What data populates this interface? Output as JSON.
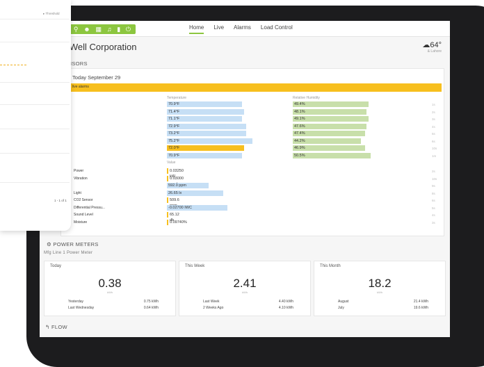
{
  "nav": {
    "icons": [
      "location-pin-icon",
      "person-icon",
      "building-icon",
      "bell-icon",
      "chart-icon",
      "power-icon"
    ],
    "tabs": [
      "Home",
      "Live",
      "Alarms",
      "Load Control"
    ]
  },
  "header": {
    "company": "lWell Corporation",
    "temperature": "64°",
    "temp_sub": "& Lahore"
  },
  "sensors": {
    "title": "SENSORS",
    "date": "Today September 29",
    "alarm_text": "live alarms",
    "temp_header": "Temperature",
    "humidity_header": "Relative Humidity",
    "value_header": "Value",
    "temp_rows": [
      {
        "temp": "70.9°F",
        "temp_pct": 0.36,
        "hum": "49.4%",
        "hum_pct": 0.39,
        "alert": false,
        "ts": "1s"
      },
      {
        "temp": "71.4°F",
        "temp_pct": 0.37,
        "hum": "48.1%",
        "hum_pct": 0.38,
        "alert": false,
        "ts": "2s"
      },
      {
        "temp": "71.1°F",
        "temp_pct": 0.36,
        "hum": "49.1%",
        "hum_pct": 0.39,
        "alert": false,
        "ts": "3s"
      },
      {
        "temp": "72.9°F",
        "temp_pct": 0.38,
        "hum": "47.6%",
        "hum_pct": 0.38,
        "alert": false,
        "ts": "4s"
      },
      {
        "temp": "73.2°F",
        "temp_pct": 0.38,
        "hum": "47.4%",
        "hum_pct": 0.37,
        "alert": false,
        "ts": "5s"
      },
      {
        "temp": "75.2°F",
        "temp_pct": 0.41,
        "hum": "44.2%",
        "hum_pct": 0.35,
        "alert": false,
        "ts": "6s"
      },
      {
        "temp": "72.0°F",
        "temp_pct": 0.37,
        "hum": "46.9%",
        "hum_pct": 0.37,
        "alert": true,
        "ts": "10s"
      },
      {
        "temp": "70.9°F",
        "temp_pct": 0.36,
        "hum": "50.5%",
        "hum_pct": 0.4,
        "alert": false,
        "ts": "1m"
      }
    ],
    "value_rows": [
      {
        "label": "Power",
        "value": "0.03250 kW",
        "pct": 0.01,
        "alert": true,
        "ts": "2s"
      },
      {
        "label": "Vibration",
        "value": "0.03000 mm/s",
        "pct": 0.01,
        "alert": false,
        "ts": "10s"
      },
      {
        "label": "",
        "value": "592.0 ppm",
        "pct": 0.2,
        "alert": false,
        "ts": "9s"
      },
      {
        "label": "Light",
        "value": "26.65 lx",
        "pct": 0.27,
        "alert": false,
        "ts": "8s"
      },
      {
        "label": "CO2 Sensor",
        "value": "509.6 ppm",
        "pct": 0.01,
        "alert": true,
        "ts": "6s"
      },
      {
        "label": "Differential Pressu...",
        "value": "-0.02700 IWC",
        "pct": 0.29,
        "alert": false,
        "ts": "5s"
      },
      {
        "label": "Sound Level",
        "value": "65.12 db",
        "pct": 0.01,
        "alert": false,
        "ts": "4s"
      },
      {
        "label": "Moisture",
        "value": "0.09740%",
        "pct": 0.01,
        "alert": true,
        "ts": "3s"
      }
    ]
  },
  "power": {
    "title": "POWER METERS",
    "meter_name": "Mfg Line 1 Power Meter",
    "cards": [
      {
        "head": "Today",
        "value": "0.38",
        "unit": "kWh",
        "rows": [
          [
            "Yesterday",
            "0.75 kWh"
          ],
          [
            "Last Wednesday",
            "0.64 kWh"
          ]
        ]
      },
      {
        "head": "This Week",
        "value": "2.41",
        "unit": "kWh",
        "rows": [
          [
            "Last Week",
            "4.40 kWh"
          ],
          [
            "2 Weeks Ago",
            "4.10 kWh"
          ]
        ]
      },
      {
        "head": "This Month",
        "value": "18.2",
        "unit": "kWh",
        "rows": [
          [
            "August",
            "21.4 kWh"
          ],
          [
            "July",
            "19.6 kWh"
          ]
        ]
      }
    ]
  },
  "flow": {
    "title": "FLOW"
  },
  "popup": {
    "title": "",
    "threshold": "Threshold",
    "pagination": "1 - 1 of 1"
  }
}
